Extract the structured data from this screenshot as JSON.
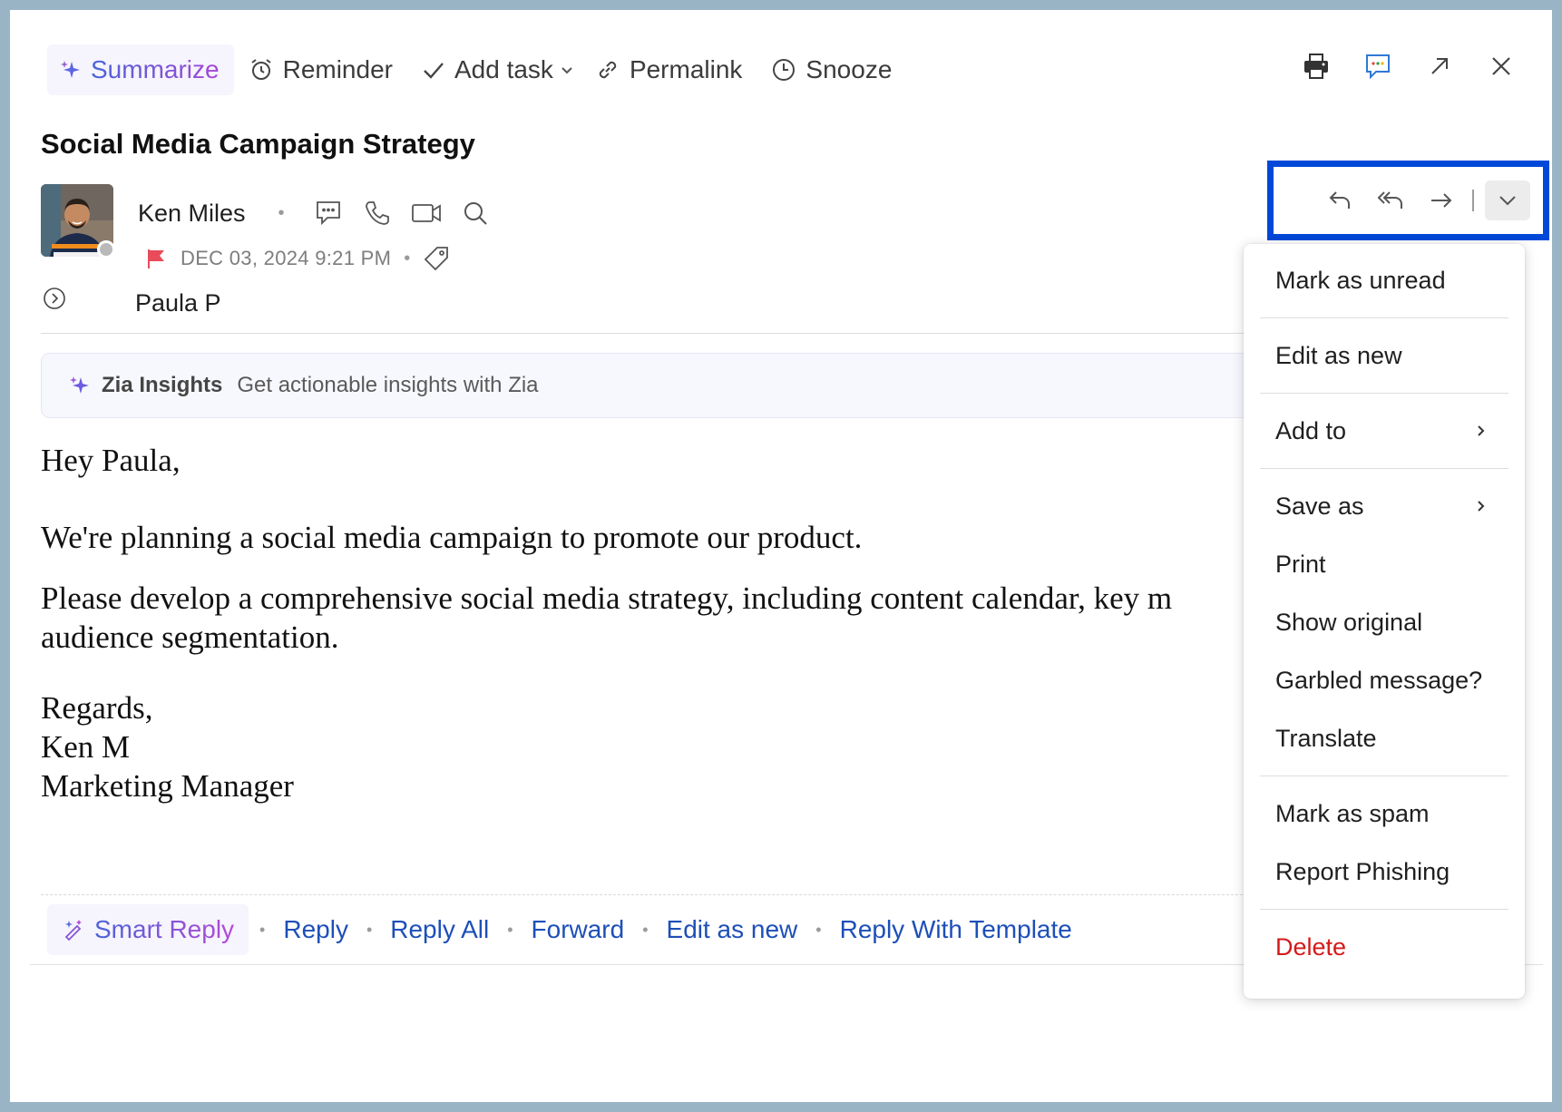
{
  "toolbar": {
    "summarize": "Summarize",
    "reminder": "Reminder",
    "add_task": "Add task",
    "permalink": "Permalink",
    "snooze": "Snooze"
  },
  "email": {
    "subject": "Social Media Campaign Strategy",
    "sender_name": "Ken Miles",
    "date": "DEC 03, 2024 9:21 PM",
    "to": "Paula P",
    "flag_color": "#e84b5a"
  },
  "zia": {
    "title": "Zia Insights",
    "subtitle": "Get actionable insights with Zia"
  },
  "body": {
    "greeting": "Hey Paula,",
    "para1": "We're planning a social media campaign to promote our product.",
    "para2_line1": "Please develop a comprehensive social media strategy, including content calendar, key m",
    "para2_line2": "audience segmentation.",
    "sign1": "Regards,",
    "sign2": "Ken M",
    "sign3": "Marketing Manager"
  },
  "reply_bar": {
    "smart_reply": "Smart Reply",
    "reply": "Reply",
    "reply_all": "Reply All",
    "forward": "Forward",
    "edit_as_new": "Edit as new",
    "reply_with_template": "Reply With Template"
  },
  "menu": {
    "mark_unread": "Mark as unread",
    "edit_as_new": "Edit as new",
    "add_to": "Add to",
    "save_as": "Save as",
    "print": "Print",
    "show_original": "Show original",
    "garbled": "Garbled message?",
    "translate": "Translate",
    "mark_spam": "Mark as spam",
    "report_phishing": "Report Phishing",
    "delete": "Delete"
  },
  "colors": {
    "link": "#1d4fb8",
    "highlight_border": "#0048d8",
    "danger": "#d51a1a"
  }
}
